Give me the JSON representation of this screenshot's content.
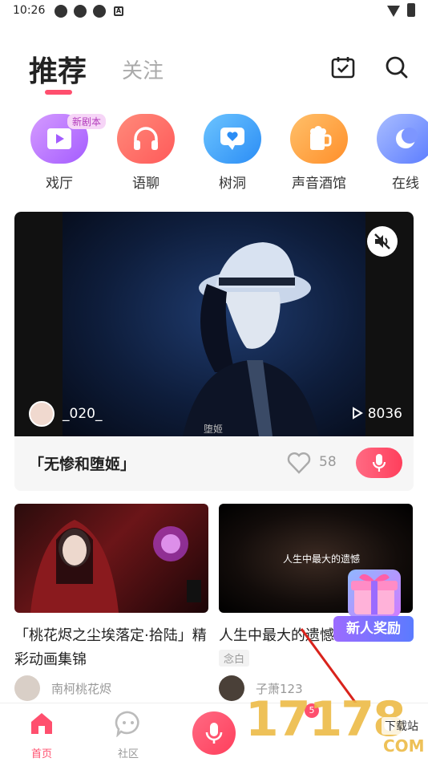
{
  "status_bar": {
    "time": "10:26",
    "letter_icon": "A"
  },
  "header": {
    "tab_active": "推荐",
    "tab_inactive": "关注",
    "accent": "#ff4f6e"
  },
  "categories": [
    {
      "label": "戏厅",
      "badge": "新剧本",
      "icon": "film-icon",
      "color": "#b66dff"
    },
    {
      "label": "语聊",
      "icon": "headphones-icon",
      "color": "#ff6b6b"
    },
    {
      "label": "树洞",
      "icon": "heart-chat-icon",
      "color": "#3aa5ff"
    },
    {
      "label": "声音酒馆",
      "icon": "beer-icon",
      "color": "#ffa43a"
    },
    {
      "label": "在线",
      "icon": "moon-icon",
      "color": "#6b8bff"
    }
  ],
  "video_card": {
    "username": "_020_",
    "plays": "8036",
    "caption": "堕姬",
    "title": "「无惨和堕姬」",
    "likes": "58"
  },
  "grid": [
    {
      "title": "「桃花烬之尘埃落定·拾陆」精彩动画集锦",
      "user": "南柯桃花烬"
    },
    {
      "title": "人生中最大的遗憾",
      "overlay": "人生中最大的遗憾",
      "tag": "念白",
      "user": "子萧123"
    }
  ],
  "reward": {
    "label": "新人奖励"
  },
  "bottom_nav": {
    "home": "首页",
    "community": "社区",
    "messages_badge": "5"
  },
  "watermark": {
    "digits": "17178",
    "download": "下载站",
    "com": "COM"
  }
}
